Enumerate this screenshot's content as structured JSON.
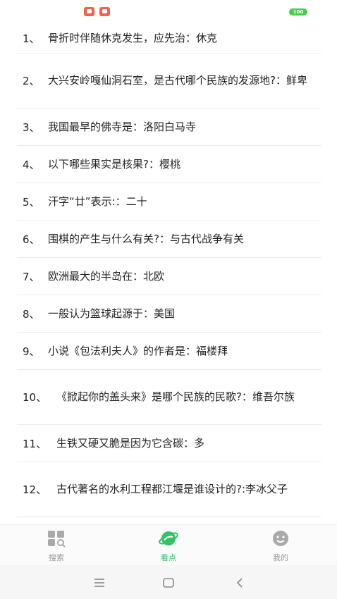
{
  "status_bar": {
    "battery": "100"
  },
  "items": [
    {
      "num": "1、",
      "text": "骨折时伴随休克发生，应先治：休克"
    },
    {
      "num": "2、",
      "text": "大兴安岭嘎仙洞石室，是古代哪个民族的发源地?：鲜卑"
    },
    {
      "num": "3、",
      "text": "我国最早的佛寺是：洛阳白马寺"
    },
    {
      "num": "4、",
      "text": "以下哪些果实是核果?：樱桃"
    },
    {
      "num": "5、",
      "text": "汗字“廿”表示:：二十"
    },
    {
      "num": "6、",
      "text": "围棋的产生与什么有关?：与古代战争有关"
    },
    {
      "num": "7、",
      "text": "欧洲最大的半岛在：北欧"
    },
    {
      "num": "8、",
      "text": "一般认为篮球起源于：美国"
    },
    {
      "num": "9、",
      "text": "小说《包法利夫人》的作者是：福楼拜"
    },
    {
      "num": "10、",
      "text": "《掀起你的盖头来》是哪个民族的民歌?：维吾尔族"
    },
    {
      "num": "11、",
      "text": "生铁又硬又脆是因为它含碳：多"
    },
    {
      "num": "12、",
      "text": "古代著名的水利工程都江堰是谁设计的?:李冰父子"
    }
  ],
  "tabs": {
    "search": "搜索",
    "watch": "看点",
    "mine": "我的"
  },
  "colors": {
    "accent": "#34c265",
    "inactive": "#9a9a9a"
  },
  "icons": {
    "search": "search-grid-icon",
    "watch": "planet-icon",
    "mine": "user-face-icon",
    "menu": "menu-icon",
    "home": "home-icon",
    "back": "back-icon"
  }
}
